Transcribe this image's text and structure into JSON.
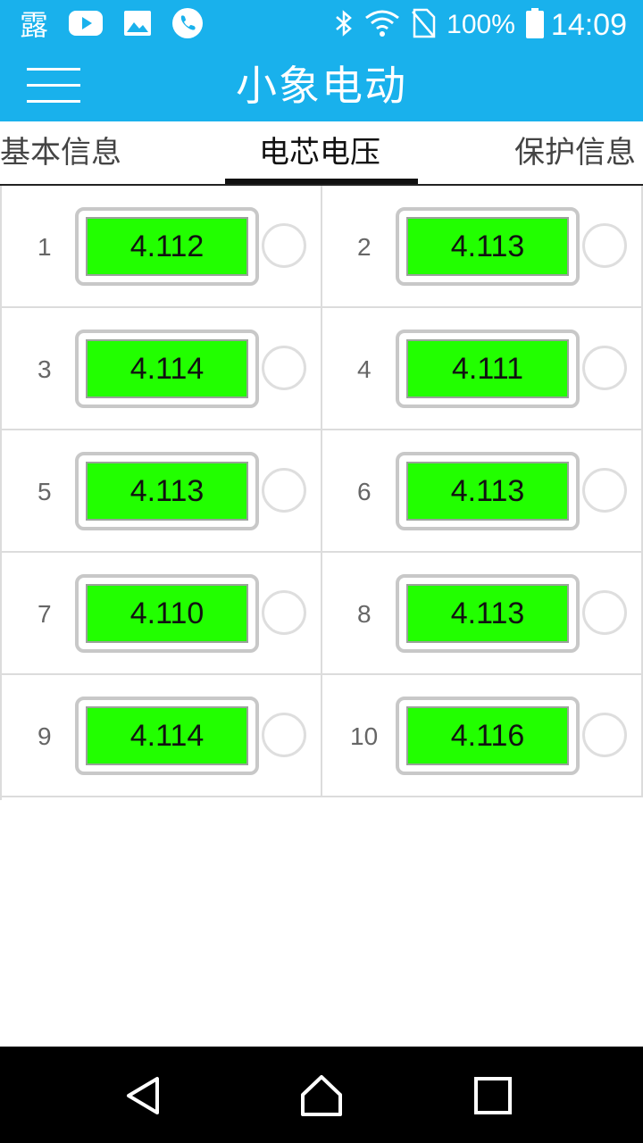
{
  "status_bar": {
    "notification_icons": [
      "sun-dew-app-icon",
      "youtube-icon",
      "gallery-icon",
      "phone-icon"
    ],
    "app_glyph": "露",
    "right_icons": [
      "bluetooth-icon",
      "wifi-icon",
      "no-sim-icon",
      "battery-icon"
    ],
    "battery_percent": "100%",
    "time": "14:09"
  },
  "app_bar": {
    "title": "小象电动",
    "menu_icon": "hamburger-menu-icon"
  },
  "tabs": [
    {
      "label": "基本信息",
      "active": false
    },
    {
      "label": "电芯电压",
      "active": true
    },
    {
      "label": "保护信息",
      "active": false
    }
  ],
  "cells": [
    {
      "index": "1",
      "voltage": "4.112"
    },
    {
      "index": "2",
      "voltage": "4.113"
    },
    {
      "index": "3",
      "voltage": "4.114"
    },
    {
      "index": "4",
      "voltage": "4.111"
    },
    {
      "index": "5",
      "voltage": "4.113"
    },
    {
      "index": "6",
      "voltage": "4.113"
    },
    {
      "index": "7",
      "voltage": "4.110"
    },
    {
      "index": "8",
      "voltage": "4.113"
    },
    {
      "index": "9",
      "voltage": "4.114"
    },
    {
      "index": "10",
      "voltage": "4.116"
    }
  ],
  "colors": {
    "header_bg": "#19b1ec",
    "voltage_ok": "#22ff00",
    "nav_bg": "#000000"
  },
  "nav_bar": {
    "icons": [
      "back-icon",
      "home-icon",
      "recents-icon"
    ]
  }
}
